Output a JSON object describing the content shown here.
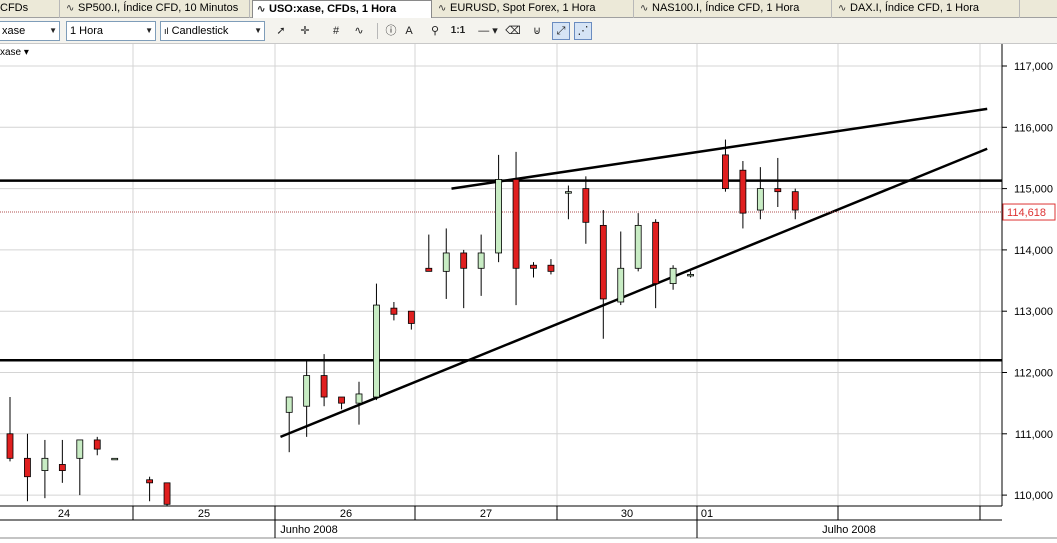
{
  "tabs": [
    {
      "label": "CFDs",
      "active": false
    },
    {
      "label": "SP500.I, Índice CFD, 10 Minutos",
      "active": false
    },
    {
      "label": "USO:xase, CFDs, 1 Hora",
      "active": true
    },
    {
      "label": "EURUSD, Spot Forex, 1 Hora",
      "active": false
    },
    {
      "label": "NAS100.I, Índice CFD, 1 Hora",
      "active": false
    },
    {
      "label": "DAX.I, Índice CFD, 1 Hora",
      "active": false
    }
  ],
  "toolbar": {
    "symbol": "xase",
    "interval": "1 Hora",
    "chart_type": "Candlestick",
    "zoom_ratio": "1:1"
  },
  "symbol_label": "xase ▾",
  "colors": {
    "bull": "#c8ecc4",
    "bear": "#e01f1f",
    "grid": "#d4d4d4",
    "trend": "#000000",
    "price_box": "#dd3333"
  },
  "chart_data": {
    "type": "candlestick",
    "ylim": [
      109.75,
      117.25
    ],
    "y_ticks": [
      "117,000",
      "116,000",
      "115,000",
      "114,000",
      "113,000",
      "112,000",
      "111,000",
      "110,000"
    ],
    "day_labels": [
      "24",
      "25",
      "26",
      "27",
      "30",
      "01"
    ],
    "month_labels": [
      "Junho 2008",
      "Julho 2008"
    ],
    "current_price": 114.618,
    "current_price_label": "114,618",
    "candles": [
      {
        "i": 0,
        "o": 111.0,
        "h": 111.6,
        "l": 110.55,
        "c": 110.6
      },
      {
        "i": 1,
        "o": 110.6,
        "h": 111.0,
        "l": 109.9,
        "c": 110.3
      },
      {
        "i": 2,
        "o": 110.4,
        "h": 110.9,
        "l": 109.95,
        "c": 110.6
      },
      {
        "i": 3,
        "o": 110.5,
        "h": 110.9,
        "l": 110.2,
        "c": 110.4
      },
      {
        "i": 4,
        "o": 110.6,
        "h": 110.9,
        "l": 110.0,
        "c": 110.9
      },
      {
        "i": 5,
        "o": 110.9,
        "h": 110.95,
        "l": 110.65,
        "c": 110.75
      },
      {
        "i": 6,
        "o": 110.6,
        "h": 110.6,
        "l": 110.6,
        "c": 110.6
      },
      {
        "i": 8,
        "o": 110.25,
        "h": 110.3,
        "l": 109.9,
        "c": 110.2
      },
      {
        "i": 9,
        "o": 110.2,
        "h": 110.2,
        "l": 109.8,
        "c": 109.85
      },
      {
        "i": 16,
        "o": 111.35,
        "h": 111.55,
        "l": 110.7,
        "c": 111.6
      },
      {
        "i": 17,
        "o": 111.45,
        "h": 112.2,
        "l": 110.95,
        "c": 111.95
      },
      {
        "i": 18,
        "o": 111.95,
        "h": 112.3,
        "l": 111.45,
        "c": 111.6
      },
      {
        "i": 19,
        "o": 111.6,
        "h": 111.6,
        "l": 111.4,
        "c": 111.5
      },
      {
        "i": 20,
        "o": 111.5,
        "h": 111.85,
        "l": 111.15,
        "c": 111.65
      },
      {
        "i": 21,
        "o": 111.6,
        "h": 113.45,
        "l": 111.55,
        "c": 113.1
      },
      {
        "i": 22,
        "o": 113.05,
        "h": 113.15,
        "l": 112.85,
        "c": 112.95
      },
      {
        "i": 23,
        "o": 113.0,
        "h": 113.0,
        "l": 112.7,
        "c": 112.8
      },
      {
        "i": 24,
        "o": 113.7,
        "h": 114.25,
        "l": 113.65,
        "c": 113.65
      },
      {
        "i": 25,
        "o": 113.65,
        "h": 114.35,
        "l": 113.2,
        "c": 113.95
      },
      {
        "i": 26,
        "o": 113.95,
        "h": 114.0,
        "l": 113.05,
        "c": 113.7
      },
      {
        "i": 27,
        "o": 113.7,
        "h": 114.25,
        "l": 113.25,
        "c": 113.95
      },
      {
        "i": 28,
        "o": 113.95,
        "h": 115.55,
        "l": 113.8,
        "c": 115.15
      },
      {
        "i": 29,
        "o": 115.15,
        "h": 115.6,
        "l": 113.1,
        "c": 113.7
      },
      {
        "i": 30,
        "o": 113.75,
        "h": 113.8,
        "l": 113.55,
        "c": 113.7
      },
      {
        "i": 31,
        "o": 113.75,
        "h": 113.85,
        "l": 113.6,
        "c": 113.65
      },
      {
        "i": 32,
        "o": 114.95,
        "h": 115.05,
        "l": 114.5,
        "c": 114.95
      },
      {
        "i": 33,
        "o": 115.0,
        "h": 115.2,
        "l": 114.1,
        "c": 114.45
      },
      {
        "i": 34,
        "o": 114.4,
        "h": 114.65,
        "l": 112.55,
        "c": 113.2
      },
      {
        "i": 35,
        "o": 113.15,
        "h": 114.3,
        "l": 113.1,
        "c": 113.7
      },
      {
        "i": 36,
        "o": 113.7,
        "h": 114.6,
        "l": 113.65,
        "c": 114.4
      },
      {
        "i": 37,
        "o": 114.45,
        "h": 114.5,
        "l": 113.05,
        "c": 113.45
      },
      {
        "i": 38,
        "o": 113.45,
        "h": 113.75,
        "l": 113.35,
        "c": 113.7
      },
      {
        "i": 39,
        "o": 113.6,
        "h": 113.65,
        "l": 113.55,
        "c": 113.6
      },
      {
        "i": 41,
        "o": 115.55,
        "h": 115.8,
        "l": 114.95,
        "c": 115.0
      },
      {
        "i": 42,
        "o": 115.3,
        "h": 115.45,
        "l": 114.35,
        "c": 114.6
      },
      {
        "i": 43,
        "o": 114.65,
        "h": 115.35,
        "l": 114.5,
        "c": 115.0
      },
      {
        "i": 44,
        "o": 115.0,
        "h": 115.5,
        "l": 114.7,
        "c": 114.95
      },
      {
        "i": 45,
        "o": 114.95,
        "h": 115.0,
        "l": 114.5,
        "c": 114.65
      }
    ],
    "horizontal_lines": [
      115.13,
      112.2
    ],
    "trendlines": [
      {
        "x1": 25.3,
        "y1": 115.0,
        "x2": 56.0,
        "y2": 116.3
      },
      {
        "x1": 15.5,
        "y1": 110.95,
        "x2": 56.0,
        "y2": 115.65
      }
    ]
  }
}
